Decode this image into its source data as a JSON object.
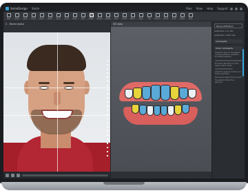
{
  "app": {
    "title": "SmileDesign",
    "menu": [
      "Smile",
      "Files",
      "View",
      "Help"
    ],
    "user": "Support"
  },
  "toolbar": {
    "tools": [
      {
        "label": "New",
        "icon": "new-icon"
      },
      {
        "label": "Open",
        "icon": "open-icon"
      },
      {
        "label": "Save",
        "icon": "save-icon"
      },
      {
        "label": "Undo",
        "icon": "undo-icon"
      },
      {
        "label": "Redo",
        "icon": "redo-icon"
      },
      {
        "label": "Photo",
        "icon": "photo-icon"
      },
      {
        "label": "Face",
        "icon": "face-icon"
      },
      {
        "label": "Lines",
        "icon": "lines-icon"
      },
      {
        "label": "Ruler",
        "icon": "ruler-icon"
      },
      {
        "label": "Grid",
        "icon": "grid-icon"
      },
      {
        "label": "Teeth",
        "icon": "teeth-icon"
      },
      {
        "label": "Shade",
        "icon": "shade-icon"
      },
      {
        "label": "Model",
        "icon": "model-icon"
      },
      {
        "label": "Jaw",
        "icon": "jaw-icon"
      },
      {
        "label": "Smile",
        "icon": "smile-icon"
      },
      {
        "label": "Mirror",
        "icon": "mirror-icon"
      },
      {
        "label": "Align",
        "icon": "align-icon"
      },
      {
        "label": "Lib",
        "icon": "library-icon"
      },
      {
        "label": "Export",
        "icon": "export-icon"
      },
      {
        "label": "Share",
        "icon": "share-icon"
      },
      {
        "label": "Print",
        "icon": "print-icon"
      },
      {
        "label": "Notes",
        "icon": "notes-icon"
      },
      {
        "label": "Help",
        "icon": "help-icon"
      }
    ]
  },
  "left_panel": {
    "title": "2 - Facial photo"
  },
  "center_panel": {
    "title": "3D view"
  },
  "right_panel": {
    "button": "New justification",
    "lines": [
      "Justification 1 for this",
      "Justification 2 with note"
    ],
    "section_title": "Comments",
    "subsection": "Clinic comments",
    "paragraphs": [
      "Treatment plan for the patient includes aesthetic evaluation and shade selection.",
      "Proposed restorations on the upper anterior teeth.",
      "Adjust the gingival contour and tooth proportions.",
      "Review the digital mock-up with the patient before final approval."
    ]
  },
  "colors": {
    "accent": "#3ea7dc",
    "tooth_blue": "#5aa9d6",
    "tooth_yellow": "#e7d33a",
    "gum": "#e06a66",
    "shirt": "#a51f2a"
  }
}
